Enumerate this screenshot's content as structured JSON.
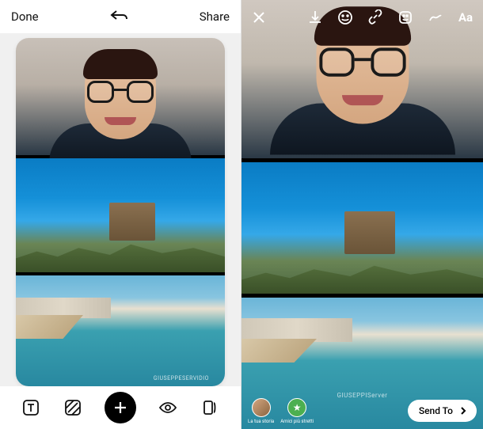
{
  "editor": {
    "header": {
      "done": "Done",
      "share": "Share"
    },
    "collage": {
      "watermark": "GIUSEPPESERVIDIO"
    },
    "toolbar": {
      "text_tool": "text",
      "pattern_tool": "pattern",
      "add_tool": "add",
      "preview_tool": "preview",
      "layout_tool": "layout"
    }
  },
  "story": {
    "top": {
      "close": "close",
      "download": "download",
      "sticker": "sticker",
      "link": "link",
      "effects": "effects",
      "draw": "draw",
      "text": "Aa"
    },
    "watermark": "GIUSEPPIServer",
    "bottom": {
      "your_story": "La tua storia",
      "close_friends": "Amici più stretti",
      "send_to": "Send To"
    }
  }
}
